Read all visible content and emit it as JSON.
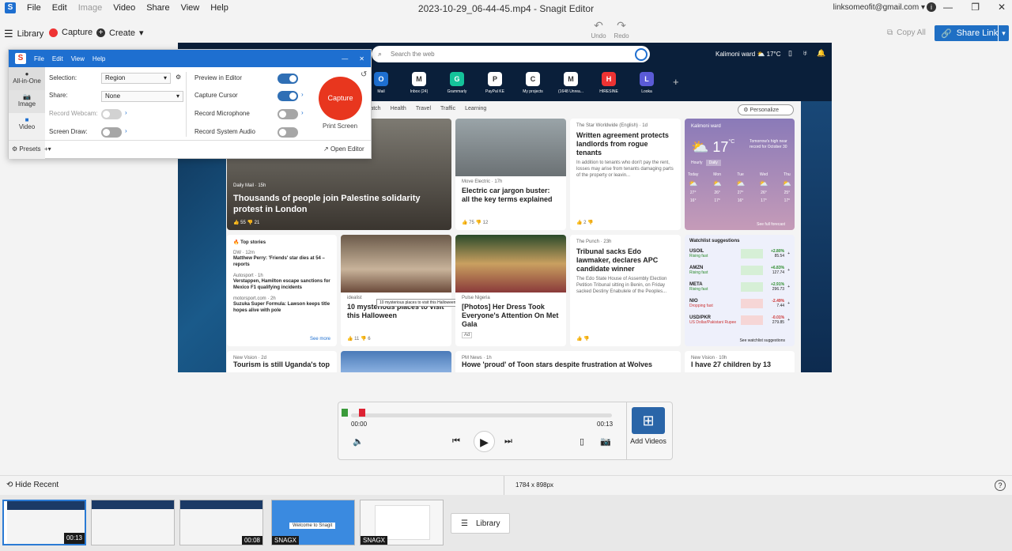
{
  "window": {
    "title": "2023-10-29_06-44-45.mp4 - Snagit Editor",
    "account": "linksomeofit@gmail.com"
  },
  "menubar": [
    "File",
    "Edit",
    "Image",
    "Video",
    "Share",
    "View",
    "Help"
  ],
  "toolbar": {
    "library": "Library",
    "capture": "Capture",
    "create": "Create",
    "undo": "Undo",
    "redo": "Redo",
    "copy_all": "Copy All",
    "share_link": "Share Link"
  },
  "capture_panel": {
    "menu": [
      "File",
      "Edit",
      "View",
      "Help"
    ],
    "modes": [
      "All-in-One",
      "Image",
      "Video"
    ],
    "selection_label": "Selection:",
    "selection_value": "Region",
    "share_label": "Share:",
    "share_value": "None",
    "webcam": "Record Webcam:",
    "screen_draw": "Screen Draw:",
    "preview": "Preview in Editor",
    "cursor": "Capture Cursor",
    "mic": "Record Microphone",
    "sysaudio": "Record System Audio",
    "capture_btn": "Capture",
    "print_screen": "Print Screen",
    "presets": "Presets",
    "open_editor": "Open Editor"
  },
  "msn": {
    "search_placeholder": "Search the web",
    "weather_loc": "Kalimoni ward",
    "weather_temp": "17°C",
    "apps": [
      {
        "label": "Mail",
        "color": "#1e6fd0",
        "glyph": "O"
      },
      {
        "label": "Inbox (24)",
        "color": "#fff",
        "glyph": "M"
      },
      {
        "label": "Grammarly",
        "color": "#15c39a",
        "glyph": "G"
      },
      {
        "label": "PayPal KE",
        "color": "#fff",
        "glyph": "P"
      },
      {
        "label": "My projects",
        "color": "#fff",
        "glyph": "C"
      },
      {
        "label": "(1648 Unrea...",
        "color": "#fff",
        "glyph": "M"
      },
      {
        "label": "HIRESINE",
        "color": "#e33",
        "glyph": "H"
      },
      {
        "label": "Looka",
        "color": "#5b5bd6",
        "glyph": "L"
      }
    ],
    "nav": [
      "Watch",
      "Health",
      "Travel",
      "Traffic",
      "Learning"
    ],
    "personalize": "Personalize",
    "hero_source": "Daily Mail · 15h",
    "hero_title": "Thousands of people join Palestine solidarity protest in London",
    "hero_likes": "55",
    "hero_dislikes": "21",
    "car_source": "Move Electric · 17h",
    "car_title": "Electric car jargon buster: all the key terms explained",
    "car_likes": "75",
    "car_dislikes": "12",
    "landlord_source": "The Star Worldwide (English) · 1d",
    "landlord_title": "Written agreement protects landlords from rogue tenants",
    "landlord_body": "In addition to tenants who don't pay the rent, losses may arise from tenants damaging parts of the property or leavin...",
    "landlord_likes": "2",
    "weather_card": {
      "loc": "Kalimoni ward",
      "temp": "17",
      "unit": "°C",
      "note": "Tomorrow's high near record for October 30",
      "tabs": [
        "Hourly",
        "Daily"
      ],
      "days": [
        "Today",
        "Mon",
        "Tue",
        "Wed",
        "Thu"
      ],
      "highs": [
        "27°",
        "26°",
        "27°",
        "26°",
        "25°"
      ],
      "lows": [
        "16°",
        "17°",
        "16°",
        "17°",
        "17°"
      ],
      "link": "See full forecast"
    },
    "top_stories": {
      "heading": "Top stories",
      "items": [
        {
          "src": "DW · 12m",
          "title": "Matthew Perry: 'Friends' star dies at 54 – reports"
        },
        {
          "src": "Autosport · 1h",
          "title": "Verstappen, Hamilton escape sanctions for Mexico F1 qualifying incidents"
        },
        {
          "src": "motorsport.com · 2h",
          "title": "Suzuka Super Formula: Lawson keeps title hopes alive with pole"
        }
      ],
      "see_more": "See more"
    },
    "halloween_src": "idealist",
    "halloween_title": "10 mysterious places to visit this Halloween",
    "tooltip": "10 mysterious places to visit this Halloween",
    "halloween_likes": "11",
    "halloween_dislikes": "6",
    "dress_src": "Pulse Nigeria",
    "dress_title": "[Photos] Her Dress Took Everyone's Attention On Met Gala",
    "ad": "Ad",
    "edo_src": "The Punch · 23h",
    "edo_title": "Tribunal sacks Edo lawmaker, declares APC candidate winner",
    "edo_body": "The Edo State House of Assembly Election Petition Tribunal sitting in Benin, on Friday sacked Destiny Enabulele of the Peoples...",
    "watchlist": {
      "heading": "Watchlist suggestions",
      "items": [
        {
          "sym": "USOIL",
          "note": "Rising fast",
          "pct": "+2.80%",
          "price": "85.54",
          "up": true
        },
        {
          "sym": "AMZN",
          "note": "Rising fast",
          "pct": "+6.83%",
          "price": "127.74",
          "up": true
        },
        {
          "sym": "META",
          "note": "Rising fast",
          "pct": "+2.91%",
          "price": "296.73",
          "up": true
        },
        {
          "sym": "NIO",
          "note": "Dropping fast",
          "pct": "-2.49%",
          "price": "7.44",
          "up": false
        },
        {
          "sym": "USD/PKR",
          "note": "US Dollar/Pakistani Rupee",
          "pct": "-0.01%",
          "price": "279.85",
          "up": false
        }
      ],
      "link": "See watchlist suggestions"
    },
    "row3": [
      {
        "src": "New Vision · 2d",
        "title": "Tourism is still Uganda's top"
      },
      {
        "src": "PM News · 1h",
        "title": "Howe 'proud' of Toon stars despite frustration at Wolves"
      },
      {
        "src": "New Vision · 10h",
        "title": "I have 27 children by 13"
      }
    ]
  },
  "player": {
    "time_start": "00:00",
    "time_end": "00:13",
    "add_videos": "Add Videos"
  },
  "status": {
    "hide_recent": "Hide Recent",
    "dims": "1784 x 898px",
    "help": "?"
  },
  "tray": {
    "thumbs": [
      {
        "label": "00:13",
        "kind": "video"
      },
      {
        "label": "",
        "kind": "video"
      },
      {
        "label": "00:08",
        "kind": "video"
      },
      {
        "label": "SNAGX",
        "kind": "snag"
      },
      {
        "label": "SNAGX",
        "kind": "snag2"
      }
    ],
    "library": "Library"
  }
}
